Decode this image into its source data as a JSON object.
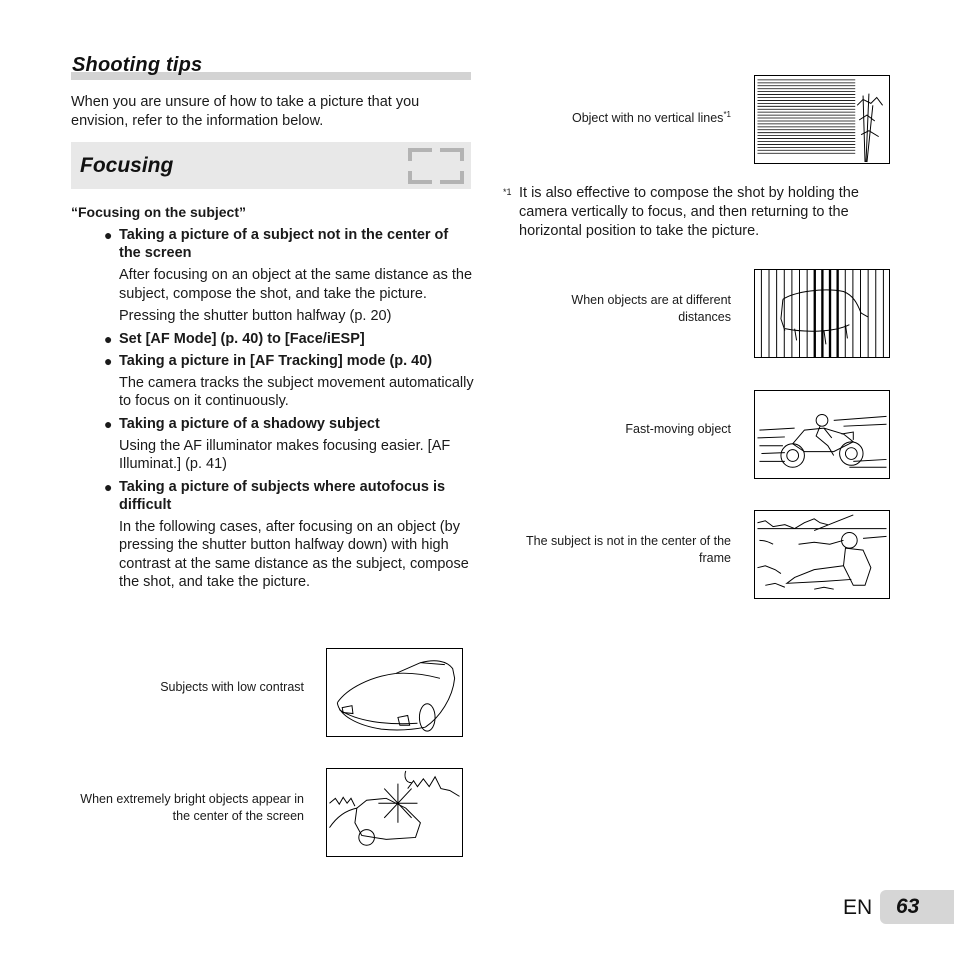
{
  "section": {
    "title": "Shooting tips",
    "intro": "When you are unsure of how to take a picture that you envision, refer to the information below."
  },
  "focusing": {
    "title": "Focusing",
    "icon": "af-frame-icon",
    "subheading": "“Focusing on the subject”",
    "items": [
      {
        "head": "Taking a picture of a subject not in the center of the screen",
        "body": [
          "After focusing on an object at the same distance as the subject, compose the shot, and take the picture.",
          "Pressing the shutter button halfway (p. 20)"
        ]
      },
      {
        "head": "Set [AF Mode] (p. 40) to [Face/iESP]",
        "body": []
      },
      {
        "head": "Taking a picture in [AF Tracking] mode (p. 40)",
        "body": [
          "The camera tracks the subject movement automatically to focus on it continuously."
        ]
      },
      {
        "head": "Taking a picture of a shadowy subject",
        "body": [
          "Using the AF illuminator makes focusing easier. [AF Illuminat.] (p. 41)"
        ]
      },
      {
        "head": "Taking a picture of subjects where autofocus is difficult",
        "body": [
          "In the following cases, after focusing on an object (by pressing the shutter button halfway down) with high contrast at the same distance as the subject, compose the shot, and take the picture."
        ]
      }
    ],
    "bullet": "●"
  },
  "examples": {
    "low_contrast": "Subjects with low contrast",
    "bright_center": "When extremely bright objects appear in the center of the screen",
    "no_vertical": "Object with no vertical lines",
    "no_vertical_mark": "*1",
    "different_distances": "When objects are at different distances",
    "fast_moving": "Fast-moving object",
    "not_centered": "The subject is not in the center of the frame"
  },
  "footnote": {
    "mark": "*1",
    "text": "It is also effective to compose the shot by holding the camera vertically to focus, and then returning to the horizontal position to take the picture."
  },
  "page": {
    "lang": "EN",
    "number": "63"
  }
}
